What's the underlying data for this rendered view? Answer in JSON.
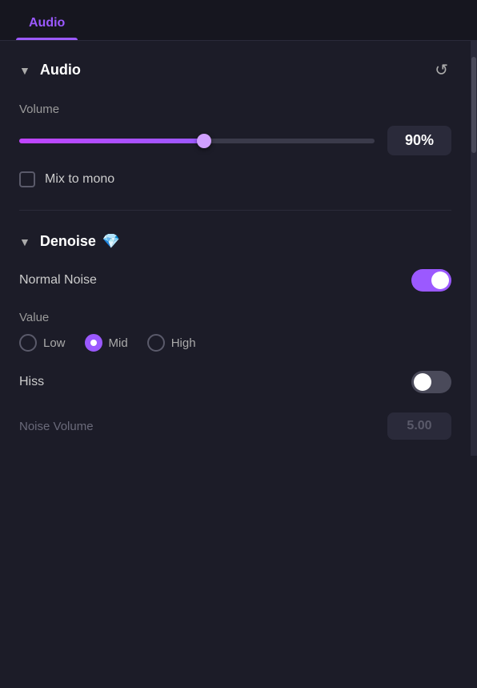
{
  "app": {
    "title": "Audio"
  },
  "tabs": [
    {
      "label": "Audio",
      "active": true
    }
  ],
  "audio_section": {
    "title": "Audio",
    "volume_label": "Volume",
    "volume_value": "90%",
    "volume_percent": 90,
    "mix_to_mono_label": "Mix to mono",
    "mix_to_mono_checked": false,
    "reset_icon": "↺"
  },
  "denoise_section": {
    "title": "Denoise",
    "badge": "💎",
    "normal_noise_label": "Normal Noise",
    "normal_noise_on": true,
    "value_label": "Value",
    "radio_options": [
      {
        "label": "Low",
        "selected": false
      },
      {
        "label": "Mid",
        "selected": true
      },
      {
        "label": "High",
        "selected": false
      }
    ],
    "hiss_label": "Hiss",
    "hiss_on": false,
    "noise_volume_label": "Noise Volume",
    "noise_volume_value": "5.00"
  },
  "colors": {
    "accent": "#9b59ff",
    "bg_dark": "#1c1c28",
    "bg_darker": "#16161f",
    "surface": "#2a2a3a"
  }
}
